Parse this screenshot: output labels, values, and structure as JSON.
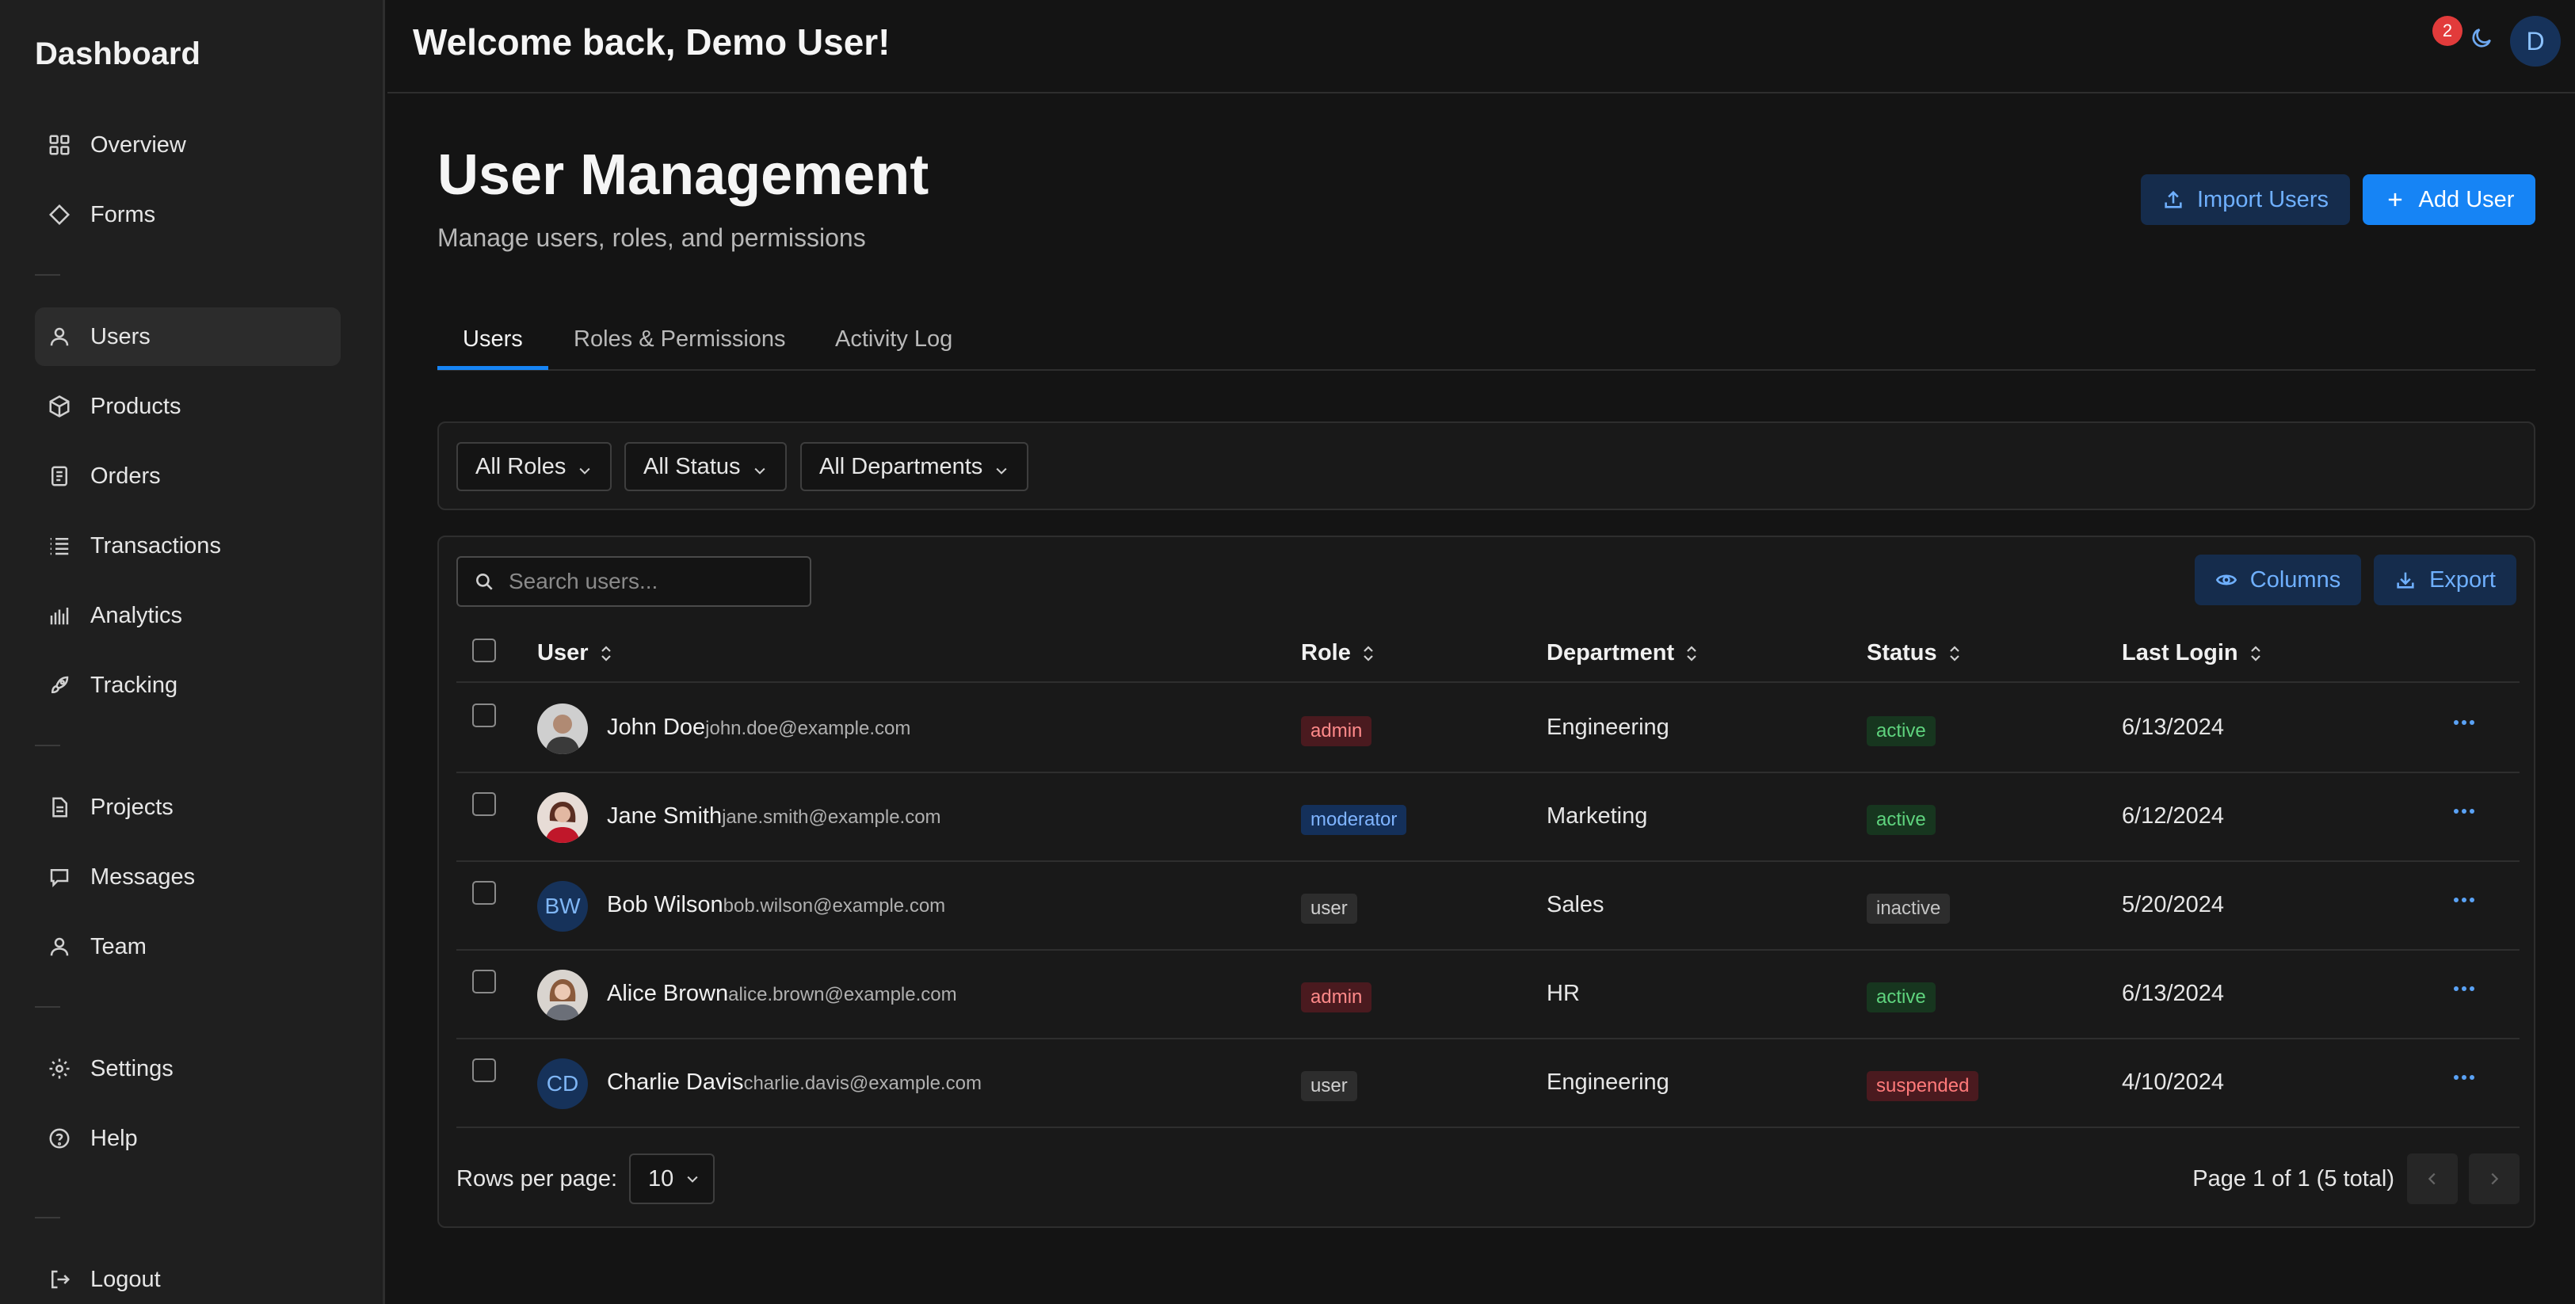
{
  "sidebar": {
    "brand": "Dashboard",
    "groups": [
      [
        {
          "label": "Overview",
          "icon": "grid-icon"
        },
        {
          "label": "Forms",
          "icon": "diamond-icon"
        }
      ],
      [
        {
          "label": "Users",
          "icon": "user-icon"
        },
        {
          "label": "Products",
          "icon": "box-icon"
        },
        {
          "label": "Orders",
          "icon": "receipt-icon"
        },
        {
          "label": "Transactions",
          "icon": "list-icon"
        },
        {
          "label": "Analytics",
          "icon": "bar-chart-icon"
        },
        {
          "label": "Tracking",
          "icon": "rocket-icon"
        }
      ],
      [
        {
          "label": "Projects",
          "icon": "document-icon"
        },
        {
          "label": "Messages",
          "icon": "message-icon"
        },
        {
          "label": "Team",
          "icon": "user-icon"
        }
      ],
      [
        {
          "label": "Settings",
          "icon": "gear-icon"
        },
        {
          "label": "Help",
          "icon": "help-circle-icon"
        }
      ],
      [
        {
          "label": "Logout",
          "icon": "logout-icon"
        }
      ]
    ],
    "active": "Users"
  },
  "header": {
    "welcome": "Welcome back, Demo User!",
    "notification_count": "2",
    "avatar_initial": "D"
  },
  "page": {
    "title": "User Management",
    "subtitle": "Manage users, roles, and permissions",
    "import_label": "Import Users",
    "add_label": "Add User"
  },
  "tabs": [
    "Users",
    "Roles & Permissions",
    "Activity Log"
  ],
  "filters": [
    "All Roles",
    "All Status",
    "All Departments"
  ],
  "table": {
    "search_placeholder": "Search users...",
    "columns_label": "Columns",
    "export_label": "Export",
    "headers": [
      "User",
      "Role",
      "Department",
      "Status",
      "Last Login"
    ],
    "rows": [
      {
        "name": "John Doe",
        "email": "john.doe@example.com",
        "role": "admin",
        "department": "Engineering",
        "status": "active",
        "last_login": "6/13/2024",
        "avatar": "photo"
      },
      {
        "name": "Jane Smith",
        "email": "jane.smith@example.com",
        "role": "moderator",
        "department": "Marketing",
        "status": "active",
        "last_login": "6/12/2024",
        "avatar": "photo"
      },
      {
        "name": "Bob Wilson",
        "email": "bob.wilson@example.com",
        "role": "user",
        "department": "Sales",
        "status": "inactive",
        "last_login": "5/20/2024",
        "avatar": "BW"
      },
      {
        "name": "Alice Brown",
        "email": "alice.brown@example.com",
        "role": "admin",
        "department": "HR",
        "status": "active",
        "last_login": "6/13/2024",
        "avatar": "photo"
      },
      {
        "name": "Charlie Davis",
        "email": "charlie.davis@example.com",
        "role": "user",
        "department": "Engineering",
        "status": "suspended",
        "last_login": "4/10/2024",
        "avatar": "CD"
      }
    ],
    "rows_per_page_label": "Rows per page:",
    "rows_per_page": "10",
    "page_info": "Page 1 of 1 (5 total)"
  },
  "colors": {
    "accent": "#1684f5",
    "background": "#141414",
    "sidebar": "#1f1f1f"
  }
}
